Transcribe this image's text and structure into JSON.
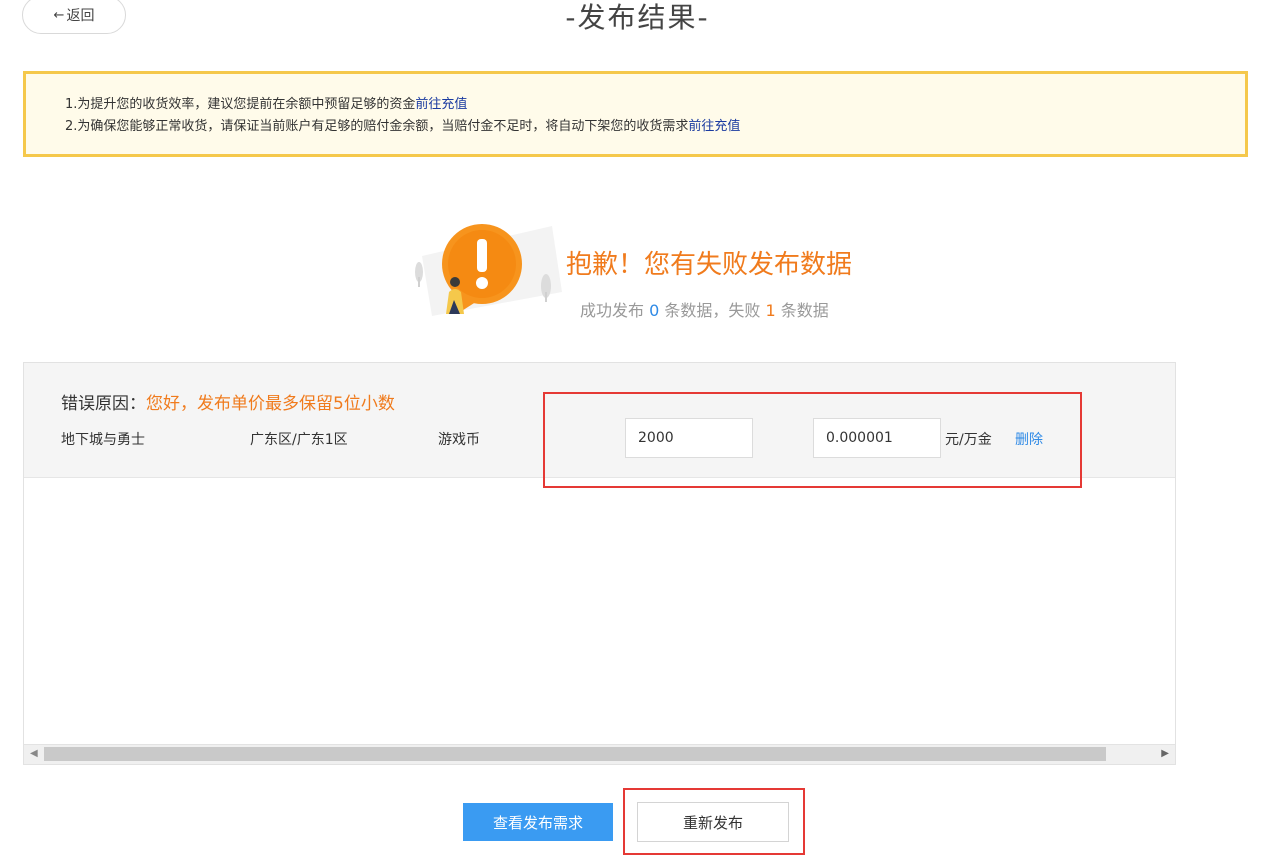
{
  "header": {
    "back_arrow": "←",
    "back_label": "返回",
    "title": "-发布结果-"
  },
  "notice": {
    "line1_text": "1.为提升您的收货效率，建议您提前在余额中预留足够的资金",
    "line1_link": "前往充值",
    "line2_text": "2.为确保您能够正常收货，请保证当前账户有足够的赔付金余额，当赔付金不足时，将自动下架您的收货需求",
    "line2_link": "前往充值",
    "border_color": "#f5c84b"
  },
  "result": {
    "title": "抱歉！您有失败发布数据",
    "summary_prefix": "成功发布 ",
    "success_count": "0",
    "summary_mid": " 条数据，失败 ",
    "fail_count": "1",
    "summary_suffix": " 条数据",
    "icon": "warning-bubble-icon",
    "accent_color": "#f07b1d"
  },
  "table": {
    "error_label": "错误原因：",
    "error_text": "您好，发布单价最多保留5位小数",
    "row": {
      "game": "地下城与勇士",
      "server": "广东区/广东1区",
      "type": "游戏币",
      "quantity": "2000",
      "price": "0.000001",
      "unit": "元/万金",
      "delete_label": "删除"
    }
  },
  "actions": {
    "view_label": "查看发布需求",
    "repost_label": "重新发布",
    "primary_color": "#3a9bf2"
  }
}
